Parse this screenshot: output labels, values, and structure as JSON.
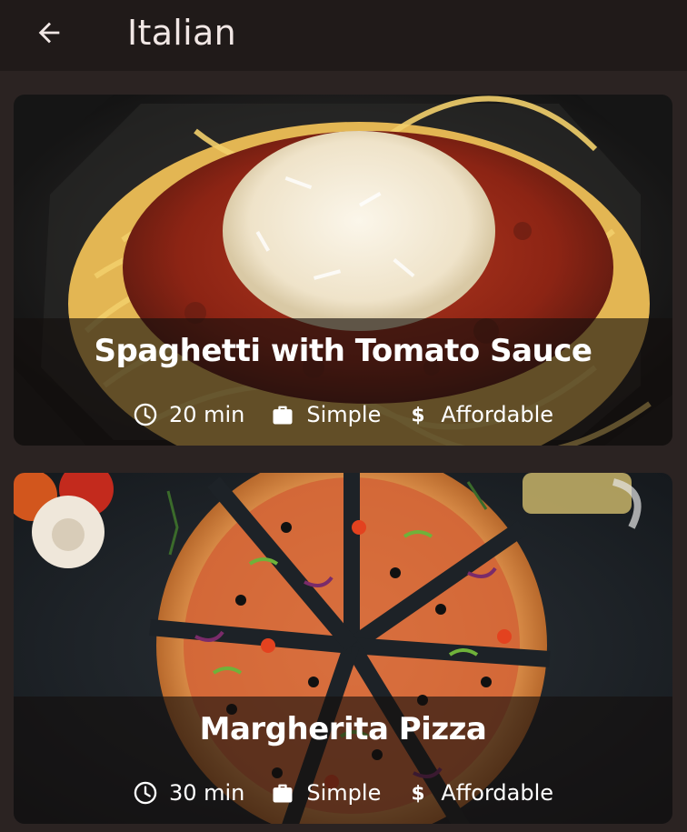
{
  "header": {
    "title": "Italian",
    "back_icon": "arrow-left-icon"
  },
  "meals": [
    {
      "title": "Spaghetti with Tomato Sauce",
      "duration": "20 min",
      "complexity": "Simple",
      "affordability": "Affordable",
      "image": "spaghetti-with-cheese-image"
    },
    {
      "title": "Margherita Pizza",
      "duration": "30 min",
      "complexity": "Simple",
      "affordability": "Affordable",
      "image": "sliced-pizza-image"
    }
  ],
  "colors": {
    "background": "#2b2322",
    "appbar": "#201a19",
    "text": "#ffffff"
  }
}
